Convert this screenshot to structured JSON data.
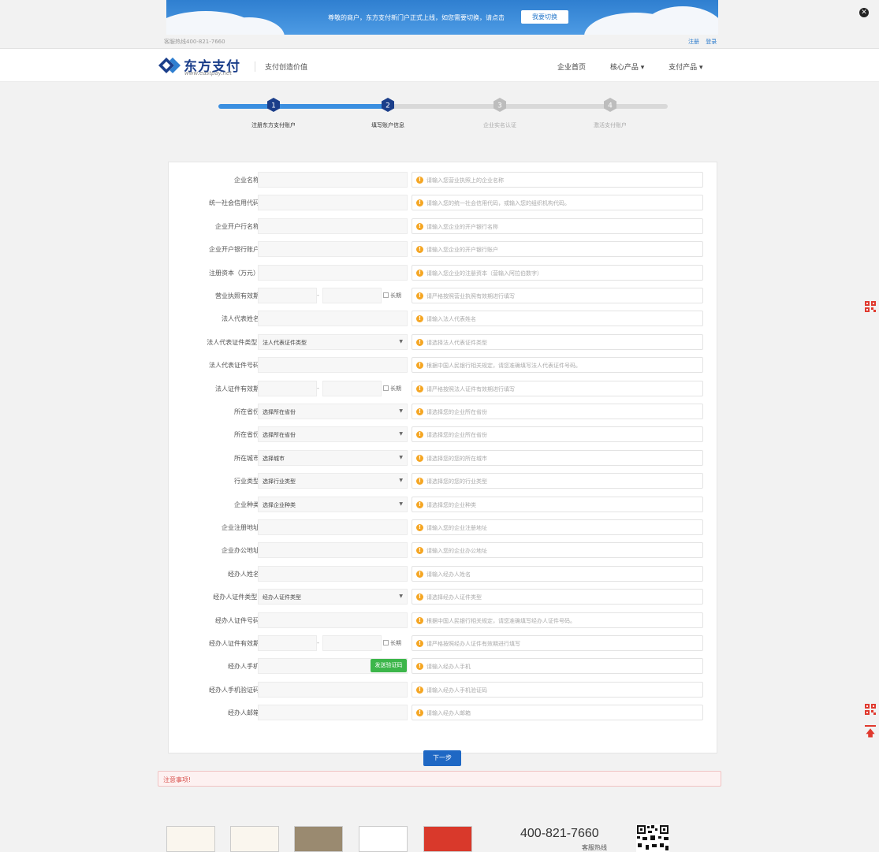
{
  "banner": {
    "text": "尊敬的商户，东方支付新门户正式上线，如您需要切换，请点击",
    "button_label": "我要切换",
    "close_icon": "close-icon"
  },
  "topbar": {
    "hotline": "客服热线400-821-7660",
    "register": "注册",
    "login": "登录"
  },
  "header": {
    "logo_cn": "东方支付",
    "logo_en": "www.eastpay.net",
    "slogan": "支付创造价值",
    "nav": [
      "企业首页",
      "核心产品 ▾",
      "支付产品 ▾"
    ]
  },
  "steps": [
    {
      "num": "1",
      "label": "注册东方支付账户",
      "state": "done"
    },
    {
      "num": "2",
      "label": "填写账户信息",
      "state": "active"
    },
    {
      "num": "3",
      "label": "企业实名认证",
      "state": "todo"
    },
    {
      "num": "4",
      "label": "激活支付账户",
      "state": "todo"
    }
  ],
  "colors": {
    "primary": "#1f68c4",
    "track_done": "#3b8fe0",
    "track_todo": "#d9d9d9",
    "hint_icon": "#f5a623",
    "send_btn": "#3cb64a",
    "notice_text": "#d9534f"
  },
  "form": {
    "long_label": "长期",
    "send_code": "发送验证码",
    "rows": [
      {
        "label": "企业名称",
        "type": "text",
        "hint": "请输入您营业执照上的企业名称"
      },
      {
        "label": "统一社会信用代码",
        "type": "text",
        "hint": "请输入您的统一社会信用代码，或输入您的组织机构代码。"
      },
      {
        "label": "企业开户行名称",
        "type": "text",
        "hint": "请输入您企业的开户银行名称"
      },
      {
        "label": "企业开户银行账户",
        "type": "text",
        "hint": "请输入您企业的开户银行账户"
      },
      {
        "label": "注册资本（万元）",
        "type": "text",
        "hint": "请输入您企业的注册资本（营输入阿拉伯数字）"
      },
      {
        "label": "营业执照有效期",
        "type": "range",
        "hint": "请严格按照营业执照有效期进行填写"
      },
      {
        "label": "法人代表姓名",
        "type": "text",
        "hint": "请输入法人代表姓名"
      },
      {
        "label": "法人代表证件类型:",
        "type": "select",
        "value": "法人代表证件类型",
        "hint": "请选择法人代表证件类型"
      },
      {
        "label": "法人代表证件号码",
        "type": "text",
        "hint": "根据中国人民银行相关规定，请您准确填写法人代表证件号码。"
      },
      {
        "label": "法人证件有效期",
        "type": "range",
        "hint": "请严格按照法人证件有效期进行填写"
      },
      {
        "label": "所在省份",
        "type": "select",
        "value": "选择所在省份",
        "hint": "请选择您的企业所在省份"
      },
      {
        "label": "所在省份",
        "type": "select",
        "value": "选择所在省份",
        "hint": "请选择您的企业所在省份"
      },
      {
        "label": "所在城市",
        "type": "select",
        "value": "选择城市",
        "hint": "请选择您的您的所在城市"
      },
      {
        "label": "行业类型",
        "type": "select",
        "value": "选择行业类型",
        "hint": "请选择您的您的行业类型"
      },
      {
        "label": "企业种类",
        "type": "select",
        "value": "选择企业种类",
        "hint": "请选择您的企业种类"
      },
      {
        "label": "企业注册地址",
        "type": "text",
        "hint": "请输入您的企业注册地址"
      },
      {
        "label": "企业办公地址",
        "type": "text",
        "hint": "请输入您的企业办公地址"
      },
      {
        "label": "经办人姓名",
        "type": "text",
        "hint": "请输入经办人姓名"
      },
      {
        "label": "经办人证件类型:",
        "type": "select",
        "value": "经办人证件类型",
        "hint": "请选择经办人证件类型"
      },
      {
        "label": "经办人证件号码",
        "type": "text",
        "hint": "根据中国人民银行相关规定，请您准确填写经办人证件号码。"
      },
      {
        "label": "经办人证件有效期",
        "type": "range",
        "hint": "请严格按照经办人证件有效期进行填写"
      },
      {
        "label": "经办人手机",
        "type": "phone",
        "hint": "请输入经办人手机"
      },
      {
        "label": "经办人手机验证码",
        "type": "text",
        "hint": "请输入经办人手机验证码"
      },
      {
        "label": "经办人邮箱",
        "type": "text",
        "hint": "请输入经办人邮箱"
      }
    ]
  },
  "actions": {
    "next": "下一步",
    "notice": "注意事项!"
  },
  "footer": {
    "phone": "400-821-7660",
    "phone_label": "客服热线"
  }
}
